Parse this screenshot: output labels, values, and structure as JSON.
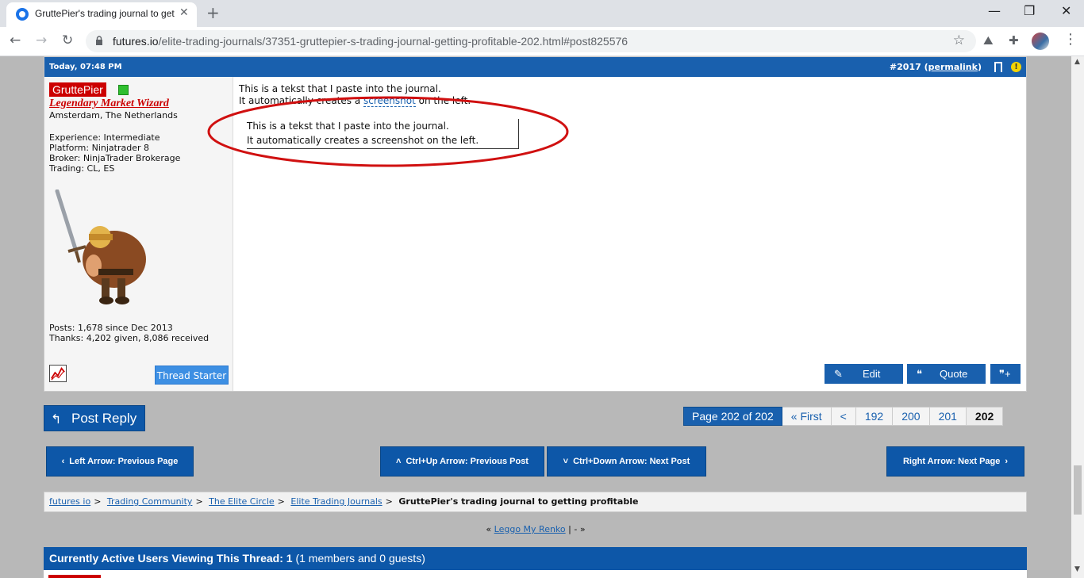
{
  "browser": {
    "tab_title": "GruttePier's trading journal to getting profitable",
    "url_host": "futures.io",
    "url_path": "/elite-trading-journals/37351-gruttepier-s-trading-journal-getting-profitable-202.html#post825576"
  },
  "post": {
    "date": "Today, 07:48 PM",
    "number": "#2017",
    "permalink_label": "permalink",
    "user": {
      "name": "GruttePier",
      "title": "Legendary Market Wizard",
      "location": "Amsterdam, The Netherlands",
      "experience": "Experience: Intermediate",
      "platform": "Platform: Ninjatrader 8",
      "broker": "Broker: NinjaTrader Brokerage",
      "trading": "Trading: CL, ES",
      "posts": "Posts: 1,678 since Dec 2013",
      "thanks": "Thanks: 4,202 given, 8,086 received",
      "thread_starter_label": "Thread Starter"
    },
    "body_line1": "This is a tekst that I paste into the journal.",
    "body_line2_pre": "It automatically creates a ",
    "body_line2_link": "screenshot",
    "body_line2_post": " on the left.",
    "screenshot_line1": "This is a tekst that I paste into the journal.",
    "screenshot_line2": "It automatically creates a screenshot on the left.",
    "actions": {
      "edit": "Edit",
      "quote": "Quote"
    }
  },
  "post_reply_label": "Post Reply",
  "pager": {
    "info": "Page 202 of 202",
    "first": "« First",
    "prev": "<",
    "pages": [
      "192",
      "200",
      "201"
    ],
    "current": "202"
  },
  "nav": {
    "prev_page": "Left Arrow: Previous Page",
    "prev_post": "Ctrl+Up Arrow: Previous Post",
    "next_post": "Ctrl+Down Arrow: Next Post",
    "next_page": "Right Arrow: Next Page"
  },
  "breadcrumb": {
    "items": [
      "futures io",
      "Trading Community",
      "The Elite Circle",
      "Elite Trading Journals"
    ],
    "current": "GruttePier's trading journal to getting profitable"
  },
  "renko": {
    "prefix": "«",
    "link": "Leggo My Renko",
    "suffix": "| - »"
  },
  "active_users": {
    "label": "Currently Active Users Viewing This Thread:",
    "count": "1",
    "detail": "(1 members and 0 guests)"
  },
  "colors": {
    "brand_blue": "#1960ae",
    "username_red": "#cc0000",
    "circle_red": "#d01010"
  }
}
